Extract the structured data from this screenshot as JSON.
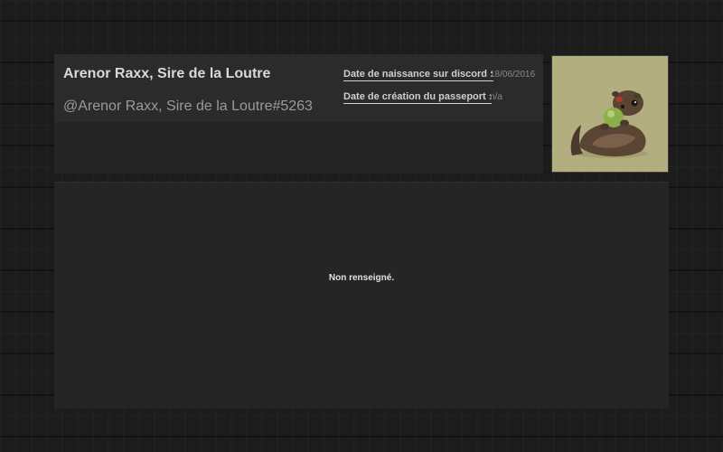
{
  "profile": {
    "display_name": "Arenor Raxx, Sire de la Loutre",
    "discord_tag": "@Arenor Raxx, Sire de la Loutre#5263",
    "birth_label": "Date de naissance sur discord :",
    "birth_value": "18/06/2016",
    "passport_label": "Date de création du passeport :",
    "passport_value": "n/a",
    "avatar_icon": "otter-avatar-icon"
  },
  "bio": {
    "text": "Non renseigné."
  },
  "colors": {
    "background": "#1c1c1c",
    "panel": "#252525",
    "header_band": "#2b2b2b",
    "avatar_bg": "#b2ae7f"
  }
}
